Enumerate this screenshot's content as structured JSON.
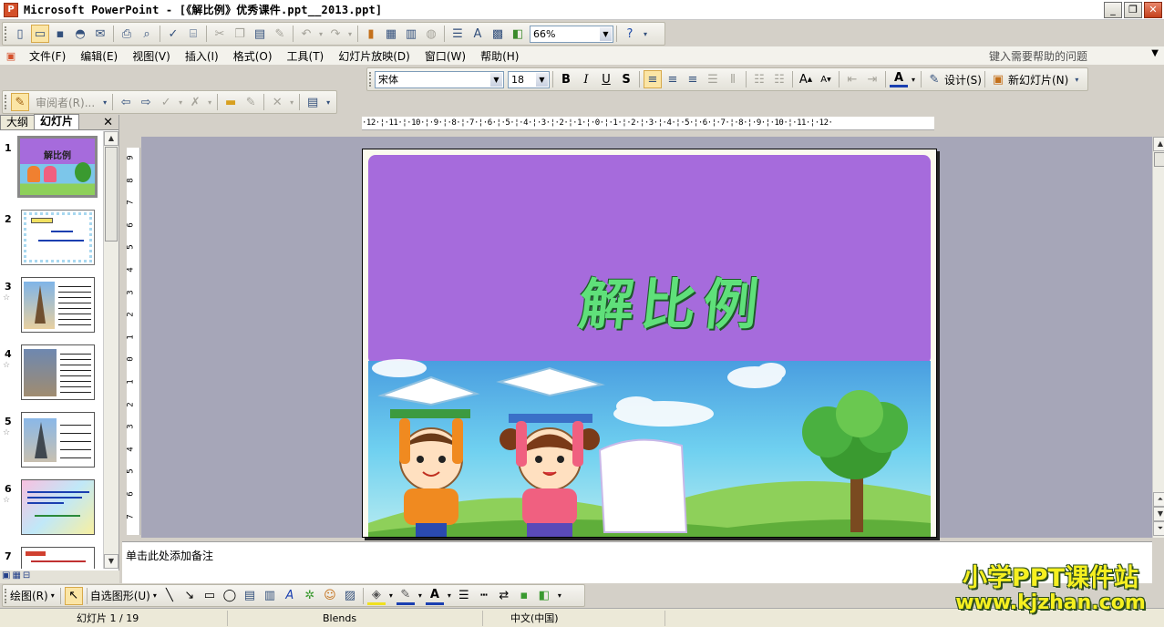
{
  "app": {
    "title": "Microsoft PowerPoint - [《解比例》优秀课件.ppt__2013.ppt]",
    "icon_label": "P"
  },
  "window_buttons": {
    "minimize": "_",
    "restore": "❐",
    "close": "✕"
  },
  "toolbar_standard": {
    "zoom": "66%"
  },
  "menu": {
    "items": [
      "文件(F)",
      "编辑(E)",
      "视图(V)",
      "插入(I)",
      "格式(O)",
      "工具(T)",
      "幻灯片放映(D)",
      "窗口(W)",
      "帮助(H)"
    ],
    "help_placeholder": "键入需要帮助的问题"
  },
  "formatting": {
    "font": "宋体",
    "size": "18",
    "bold": "B",
    "italic": "I",
    "underline": "U",
    "shadow": "S",
    "design_label": "设计(S)",
    "new_slide_label": "新幻灯片(N)",
    "font_color_icon": "A"
  },
  "reviewing": {
    "reviewer_label": "审阅者(R)..."
  },
  "ruler": {
    "text": "·12·¦·11·¦·10·¦·9·¦·8·¦·7·¦·6·¦·5·¦·4·¦·3·¦·2·¦·1·¦·0·¦·1·¦·2·¦·3·¦·4·¦·5·¦·6·¦·7·¦·8·¦·9·¦·10·¦·11·¦·12·"
  },
  "vruler": {
    "ticks": [
      "9",
      "8",
      "7",
      "6",
      "5",
      "4",
      "3",
      "2",
      "1",
      "0",
      "1",
      "2",
      "3",
      "4",
      "5",
      "6",
      "7"
    ]
  },
  "left_pane": {
    "tabs": [
      "大纲",
      "幻灯片"
    ],
    "active_tab": "幻灯片",
    "close": "✕",
    "thumbs": [
      {
        "num": "1",
        "star": ""
      },
      {
        "num": "2",
        "star": ""
      },
      {
        "num": "3",
        "star": "☆"
      },
      {
        "num": "4",
        "star": "☆"
      },
      {
        "num": "5",
        "star": "☆"
      },
      {
        "num": "6",
        "star": "☆"
      },
      {
        "num": "7",
        "star": ""
      }
    ]
  },
  "slide": {
    "title": "解比例"
  },
  "notes": {
    "placeholder": "单击此处添加备注"
  },
  "drawing": {
    "draw_label": "绘图(R)",
    "autoshape_label": "自选图形(U)"
  },
  "status": {
    "slide_info": "幻灯片 1 / 19",
    "design": "Blends",
    "language": "中文(中国)"
  },
  "watermark": {
    "line1": "小学PPT课件站",
    "line2": "www.kjzhan.com"
  },
  "colors": {
    "slide_purple": "#a66bdc",
    "title_green": "#5fe07a",
    "sky": "#58b8e8"
  }
}
